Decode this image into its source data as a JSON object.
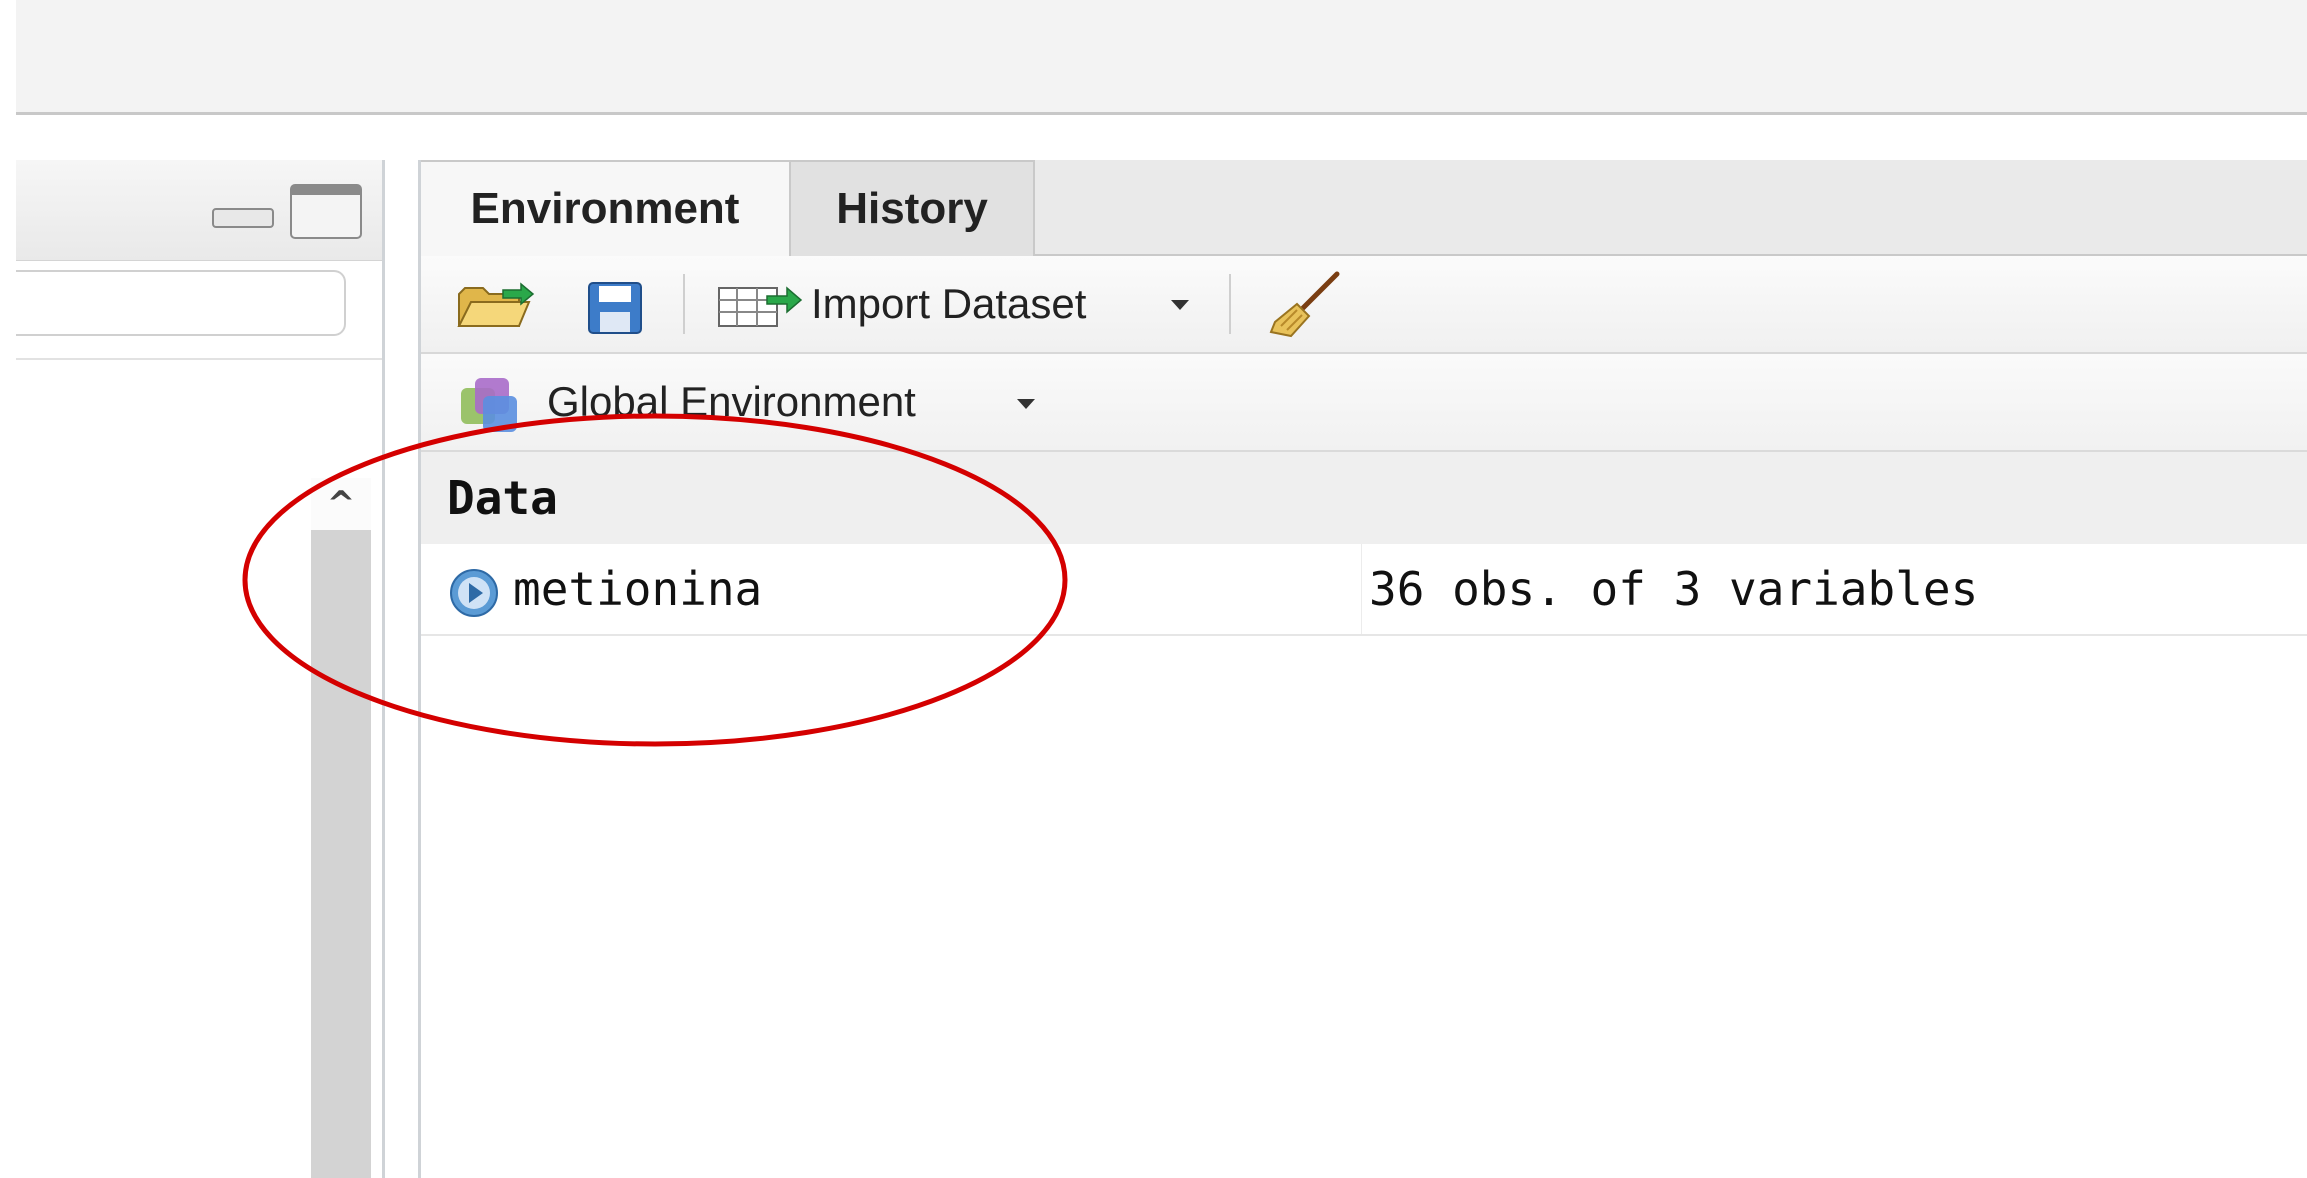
{
  "tabs": [
    {
      "label": "Environment",
      "active": true
    },
    {
      "label": "History",
      "active": false
    }
  ],
  "toolbar": {
    "import_label": "Import Dataset",
    "icons": [
      "open-folder-icon",
      "save-icon",
      "import-dataset-icon",
      "broom-clear-icon"
    ]
  },
  "environment": {
    "selector_label": "Global Environment",
    "section_header": "Data",
    "rows": [
      {
        "name": "metionina",
        "value": "36 obs. of 3 variables"
      }
    ]
  },
  "colors": {
    "annotation": "#d40000",
    "row_icon": "#5b9bd5",
    "scrollbar": "#d3d3d3"
  }
}
